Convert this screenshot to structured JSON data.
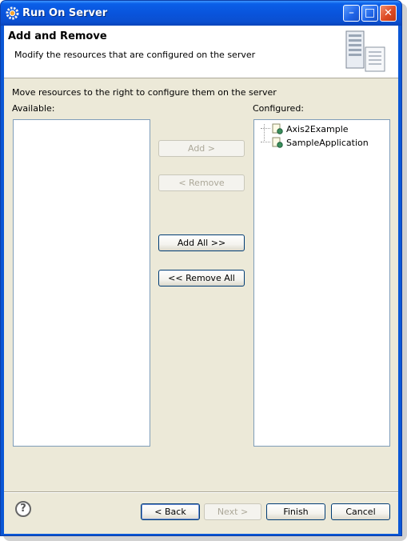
{
  "window": {
    "title": "Run On Server",
    "minimize_glyph": "_",
    "maximize_glyph": "□",
    "close_glyph": "✕"
  },
  "header": {
    "title": "Add and Remove",
    "description": "Modify the resources that are configured on the server",
    "icon": "server-wizard-icon"
  },
  "body": {
    "instruction": "Move resources to the right to configure them on the server",
    "available_label": "Available:",
    "configured_label": "Configured:",
    "available_items": [],
    "configured_items": [
      {
        "label": "Axis2Example",
        "icon": "web-module-icon"
      },
      {
        "label": "SampleApplication",
        "icon": "web-module-icon"
      }
    ]
  },
  "buttons": {
    "add": {
      "label": "Add >",
      "enabled": false
    },
    "remove": {
      "label": "< Remove",
      "enabled": false
    },
    "add_all": {
      "label": "Add All >>",
      "enabled": true
    },
    "remove_all": {
      "label": "<< Remove All",
      "enabled": true
    }
  },
  "footer": {
    "help_glyph": "?",
    "back": {
      "label": "< Back",
      "enabled": true
    },
    "next": {
      "label": "Next >",
      "enabled": false
    },
    "finish": {
      "label": "Finish",
      "enabled": true
    },
    "cancel": {
      "label": "Cancel",
      "enabled": true
    }
  },
  "colors": {
    "titlebar": "#0a57d6",
    "dialog_bg": "#ece9d8",
    "list_border": "#7f9db9"
  }
}
